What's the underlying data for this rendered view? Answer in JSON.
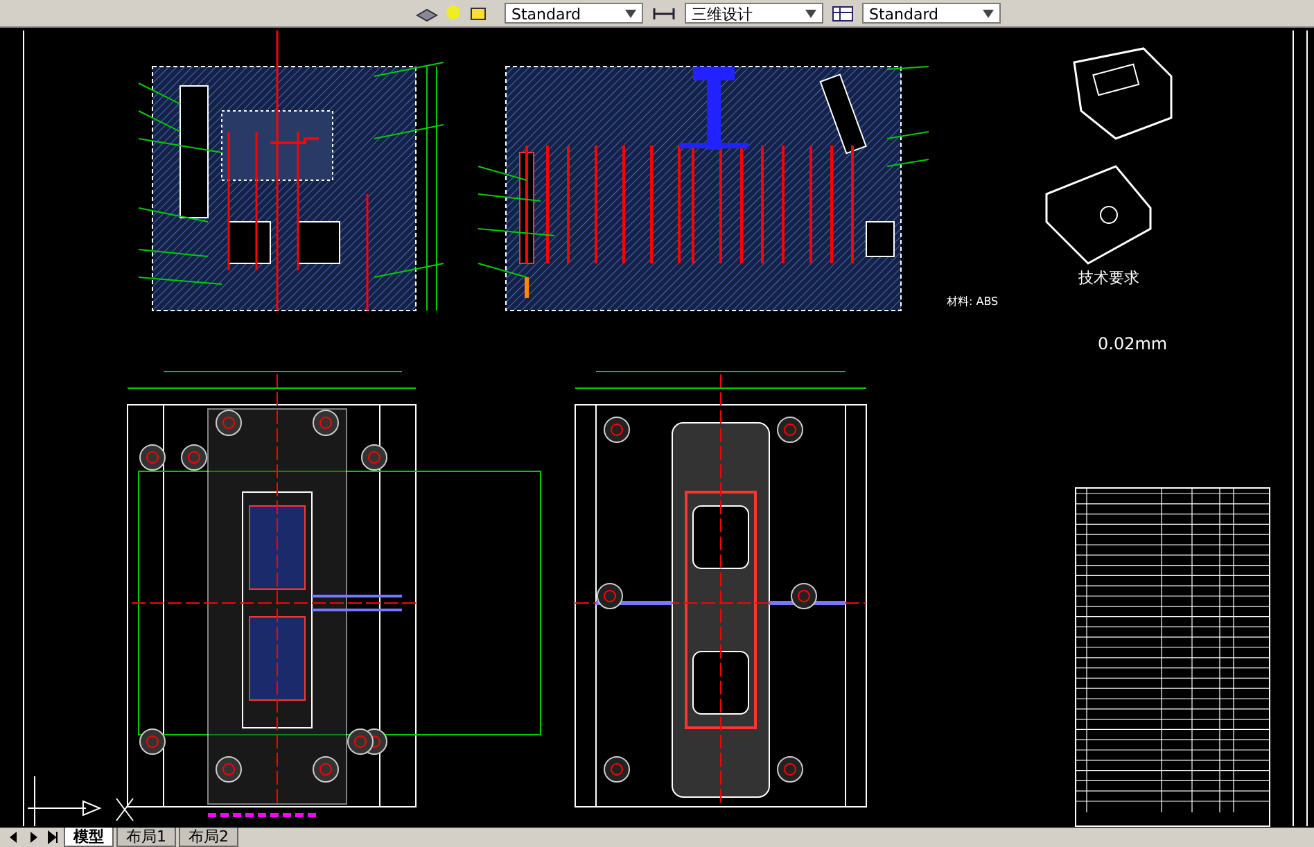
{
  "toolbar": {
    "dropdowns": [
      {
        "value": "Standard"
      },
      {
        "value": "三维设计"
      },
      {
        "value": "Standard"
      }
    ]
  },
  "drawing": {
    "material": "材料: ABS",
    "requirements_title": "技术要求",
    "tolerance": "0.02mm"
  },
  "tabs": [
    {
      "label": "模型",
      "selected": true
    },
    {
      "label": "布局1",
      "selected": false
    },
    {
      "label": "布局2",
      "selected": false
    }
  ]
}
